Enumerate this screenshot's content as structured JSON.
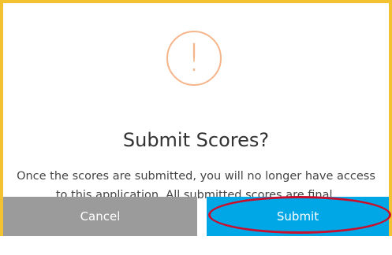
{
  "dialog": {
    "icon": "exclamation-icon",
    "icon_glyph": "!",
    "title": "Submit Scores?",
    "message": "Once the scores are submitted, you will no longer have access to this application. All submitted scores are final.",
    "cancel_label": "Cancel",
    "submit_label": "Submit"
  },
  "colors": {
    "frame_border": "#f2c230",
    "icon": "#f5b58a",
    "cancel_button": "#9b9b9b",
    "submit_button": "#00a7e6",
    "highlight_ring": "#c8102e"
  }
}
